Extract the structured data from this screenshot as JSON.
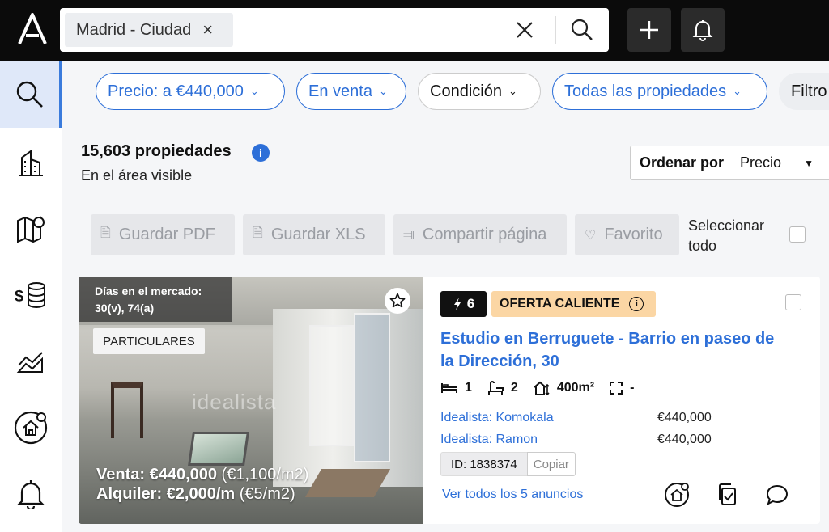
{
  "search": {
    "chip_label": "Madrid - Ciudad",
    "chip_remove": "×"
  },
  "filters": [
    {
      "label": "Precio: a €440,000"
    },
    {
      "label": "En venta"
    },
    {
      "label": "Condición"
    },
    {
      "label": "Todas las propiedades"
    },
    {
      "label": "Filtro"
    }
  ],
  "results": {
    "count": "15,603 propiedades",
    "info": "i",
    "area": "En el área visible"
  },
  "sort": {
    "label": "Ordenar por",
    "value": "Precio"
  },
  "actions": {
    "pdf": "Guardar PDF",
    "xls": "Guardar XLS",
    "share": "Compartir página",
    "favorite": "Favorito",
    "select_all_1": "Seleccionar",
    "select_all_2": "todo"
  },
  "listing": {
    "days_label": "Días en el mercado:",
    "days_value": "30(v), 74(a)",
    "seller_tag": "PARTICULARES",
    "watermark": "idealista",
    "sale_label": "Venta: €440,000",
    "sale_sqm": " (€1,100/m2)",
    "rent_label": "Alquiler: €2,000/m",
    "rent_sqm": " (€5/m2)",
    "score": "6",
    "hot_label": "OFERTA CALIENTE",
    "title_line1": "Estudio en Berruguete - Barrio en paseo de",
    "title_line2": "la Dirección, 30",
    "beds": "1",
    "baths": "2",
    "size": "400m²",
    "plot": "-",
    "agents": [
      {
        "name": "Idealista: Komokala",
        "price": "€440,000"
      },
      {
        "name": "Idealista: Ramon",
        "price": "€440,000"
      }
    ],
    "id_label": "ID: 1838374",
    "copy_label": "Copiar",
    "see_all": "Ver todos los 5 anuncios"
  },
  "colors": {
    "accent": "#2d6fd8",
    "topbar": "#0b0b0b",
    "hot_badge": "#fbd6a4",
    "active_nav": "#dfe8f9"
  }
}
